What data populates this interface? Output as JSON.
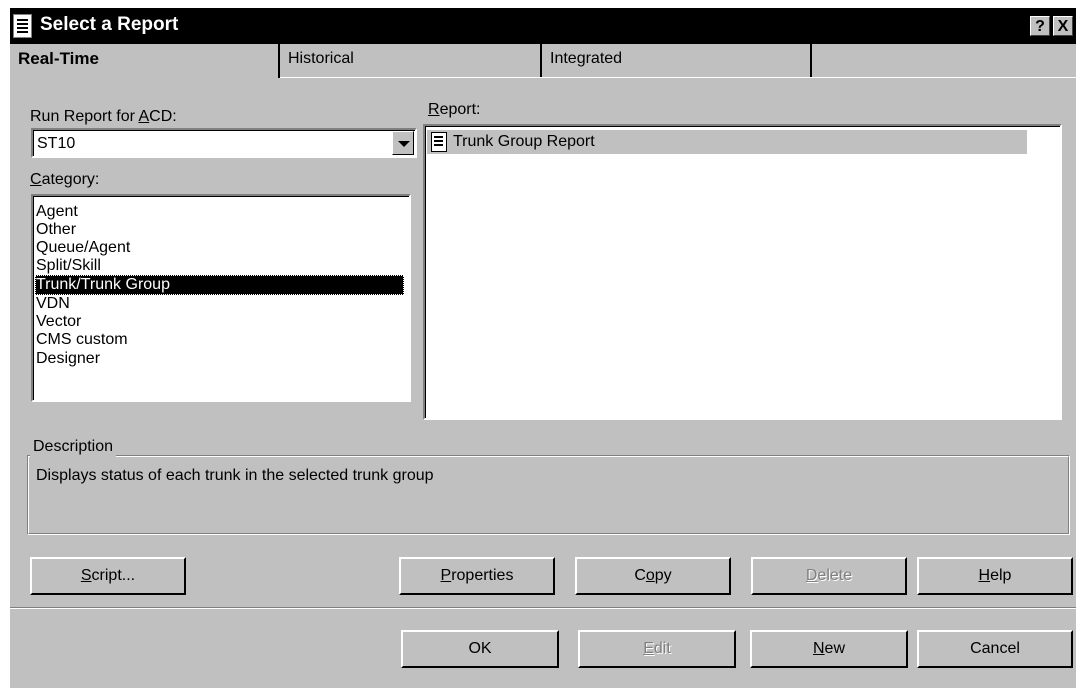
{
  "window": {
    "title": "Select a Report",
    "help_button": "?",
    "close_button": "X"
  },
  "tabs": [
    {
      "label": "Real-Time",
      "active": true
    },
    {
      "label": "Historical",
      "active": false
    },
    {
      "label": "Integrated",
      "active": false
    }
  ],
  "acd": {
    "label_pre": "Run Report for ",
    "label_mnemonic": "A",
    "label_post": "CD:",
    "value": "ST10"
  },
  "category": {
    "label_mnemonic": "C",
    "label_rest": "ategory:",
    "items": [
      "Agent",
      "Other",
      "Queue/Agent",
      "Split/Skill",
      "Trunk/Trunk Group",
      "VDN",
      "Vector",
      "CMS custom",
      "Designer"
    ],
    "selected": "Trunk/Trunk Group"
  },
  "report": {
    "label_mnemonic": "R",
    "label_rest": "eport:",
    "items": [
      "Trunk Group Report"
    ]
  },
  "description": {
    "legend": "Description",
    "text": "Displays status of each trunk in the selected trunk group"
  },
  "buttons_row1": {
    "script": {
      "m": "S",
      "rest": "cript..."
    },
    "properties": {
      "m": "P",
      "rest": "roperties"
    },
    "copy": {
      "pre": "C",
      "m": "o",
      "rest": "py"
    },
    "delete": {
      "m": "D",
      "rest": "elete"
    },
    "help": {
      "m": "H",
      "rest": "elp"
    }
  },
  "buttons_row2": {
    "ok": "OK",
    "edit": {
      "m": "E",
      "rest": "dit"
    },
    "new": {
      "m": "N",
      "rest": "ew"
    },
    "cancel": "Cancel"
  },
  "colors": {
    "dialog_bg": "#c0c0c0",
    "titlebar": "#000000",
    "selection": "#000000"
  }
}
